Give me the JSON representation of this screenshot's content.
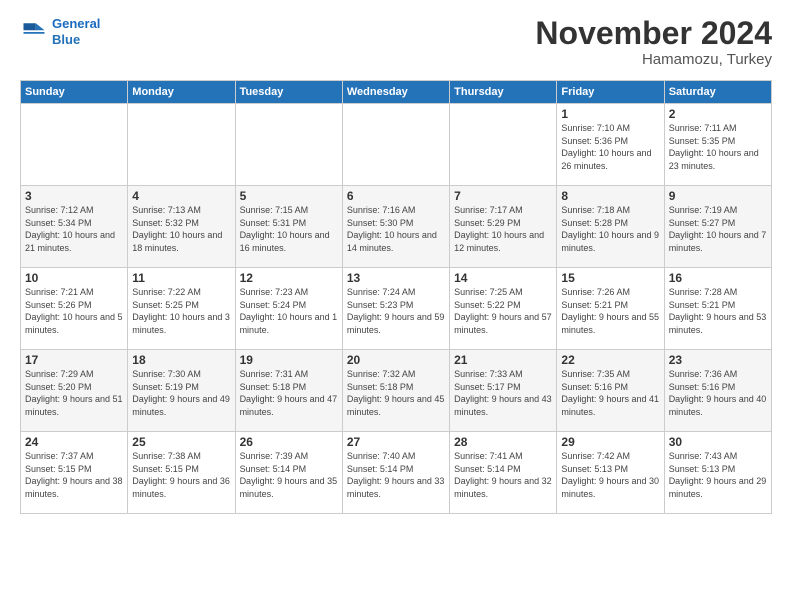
{
  "header": {
    "logo_line1": "General",
    "logo_line2": "Blue",
    "month": "November 2024",
    "location": "Hamamozu, Turkey"
  },
  "days_of_week": [
    "Sunday",
    "Monday",
    "Tuesday",
    "Wednesday",
    "Thursday",
    "Friday",
    "Saturday"
  ],
  "weeks": [
    [
      {
        "day": "",
        "info": ""
      },
      {
        "day": "",
        "info": ""
      },
      {
        "day": "",
        "info": ""
      },
      {
        "day": "",
        "info": ""
      },
      {
        "day": "",
        "info": ""
      },
      {
        "day": "1",
        "info": "Sunrise: 7:10 AM\nSunset: 5:36 PM\nDaylight: 10 hours and 26 minutes."
      },
      {
        "day": "2",
        "info": "Sunrise: 7:11 AM\nSunset: 5:35 PM\nDaylight: 10 hours and 23 minutes."
      }
    ],
    [
      {
        "day": "3",
        "info": "Sunrise: 7:12 AM\nSunset: 5:34 PM\nDaylight: 10 hours and 21 minutes."
      },
      {
        "day": "4",
        "info": "Sunrise: 7:13 AM\nSunset: 5:32 PM\nDaylight: 10 hours and 18 minutes."
      },
      {
        "day": "5",
        "info": "Sunrise: 7:15 AM\nSunset: 5:31 PM\nDaylight: 10 hours and 16 minutes."
      },
      {
        "day": "6",
        "info": "Sunrise: 7:16 AM\nSunset: 5:30 PM\nDaylight: 10 hours and 14 minutes."
      },
      {
        "day": "7",
        "info": "Sunrise: 7:17 AM\nSunset: 5:29 PM\nDaylight: 10 hours and 12 minutes."
      },
      {
        "day": "8",
        "info": "Sunrise: 7:18 AM\nSunset: 5:28 PM\nDaylight: 10 hours and 9 minutes."
      },
      {
        "day": "9",
        "info": "Sunrise: 7:19 AM\nSunset: 5:27 PM\nDaylight: 10 hours and 7 minutes."
      }
    ],
    [
      {
        "day": "10",
        "info": "Sunrise: 7:21 AM\nSunset: 5:26 PM\nDaylight: 10 hours and 5 minutes."
      },
      {
        "day": "11",
        "info": "Sunrise: 7:22 AM\nSunset: 5:25 PM\nDaylight: 10 hours and 3 minutes."
      },
      {
        "day": "12",
        "info": "Sunrise: 7:23 AM\nSunset: 5:24 PM\nDaylight: 10 hours and 1 minute."
      },
      {
        "day": "13",
        "info": "Sunrise: 7:24 AM\nSunset: 5:23 PM\nDaylight: 9 hours and 59 minutes."
      },
      {
        "day": "14",
        "info": "Sunrise: 7:25 AM\nSunset: 5:22 PM\nDaylight: 9 hours and 57 minutes."
      },
      {
        "day": "15",
        "info": "Sunrise: 7:26 AM\nSunset: 5:21 PM\nDaylight: 9 hours and 55 minutes."
      },
      {
        "day": "16",
        "info": "Sunrise: 7:28 AM\nSunset: 5:21 PM\nDaylight: 9 hours and 53 minutes."
      }
    ],
    [
      {
        "day": "17",
        "info": "Sunrise: 7:29 AM\nSunset: 5:20 PM\nDaylight: 9 hours and 51 minutes."
      },
      {
        "day": "18",
        "info": "Sunrise: 7:30 AM\nSunset: 5:19 PM\nDaylight: 9 hours and 49 minutes."
      },
      {
        "day": "19",
        "info": "Sunrise: 7:31 AM\nSunset: 5:18 PM\nDaylight: 9 hours and 47 minutes."
      },
      {
        "day": "20",
        "info": "Sunrise: 7:32 AM\nSunset: 5:18 PM\nDaylight: 9 hours and 45 minutes."
      },
      {
        "day": "21",
        "info": "Sunrise: 7:33 AM\nSunset: 5:17 PM\nDaylight: 9 hours and 43 minutes."
      },
      {
        "day": "22",
        "info": "Sunrise: 7:35 AM\nSunset: 5:16 PM\nDaylight: 9 hours and 41 minutes."
      },
      {
        "day": "23",
        "info": "Sunrise: 7:36 AM\nSunset: 5:16 PM\nDaylight: 9 hours and 40 minutes."
      }
    ],
    [
      {
        "day": "24",
        "info": "Sunrise: 7:37 AM\nSunset: 5:15 PM\nDaylight: 9 hours and 38 minutes."
      },
      {
        "day": "25",
        "info": "Sunrise: 7:38 AM\nSunset: 5:15 PM\nDaylight: 9 hours and 36 minutes."
      },
      {
        "day": "26",
        "info": "Sunrise: 7:39 AM\nSunset: 5:14 PM\nDaylight: 9 hours and 35 minutes."
      },
      {
        "day": "27",
        "info": "Sunrise: 7:40 AM\nSunset: 5:14 PM\nDaylight: 9 hours and 33 minutes."
      },
      {
        "day": "28",
        "info": "Sunrise: 7:41 AM\nSunset: 5:14 PM\nDaylight: 9 hours and 32 minutes."
      },
      {
        "day": "29",
        "info": "Sunrise: 7:42 AM\nSunset: 5:13 PM\nDaylight: 9 hours and 30 minutes."
      },
      {
        "day": "30",
        "info": "Sunrise: 7:43 AM\nSunset: 5:13 PM\nDaylight: 9 hours and 29 minutes."
      }
    ]
  ]
}
